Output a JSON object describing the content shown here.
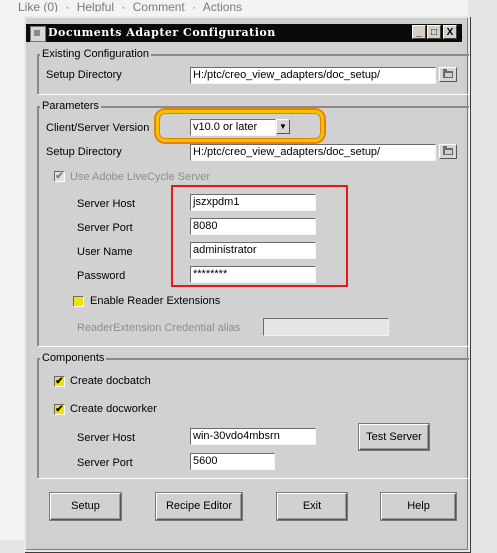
{
  "background": {
    "links": [
      "Like (0)",
      "·",
      "Helpful",
      "·",
      "Comment",
      "·",
      "Actions"
    ]
  },
  "window": {
    "title": "Documents Adapter Configuration",
    "buttons": {
      "minimize": "_",
      "maximize": "□",
      "close": "X"
    }
  },
  "existing_configuration": {
    "legend": "Existing Configuration",
    "setup_directory_label": "Setup Directory",
    "setup_directory_value": "H:/ptc/creo_view_adapters/doc_setup/"
  },
  "parameters": {
    "legend": "Parameters",
    "client_server_version_label": "Client/Server Version",
    "client_server_version_value": "v10.0 or later",
    "setup_directory_label": "Setup Directory",
    "setup_directory_value": "H:/ptc/creo_view_adapters/doc_setup/",
    "use_livecycle_label": "Use Adobe LiveCycle Server",
    "server_host_label": "Server Host",
    "server_host_value": "jszxpdm1",
    "server_port_label": "Server Port",
    "server_port_value": "8080",
    "user_name_label": "User Name",
    "user_name_value": "administrator",
    "password_label": "Password",
    "password_value": "********",
    "enable_reader_extensions_label": "Enable Reader Extensions",
    "reader_extension_alias_label": "ReaderExtension Credential alias",
    "reader_extension_alias_value": ""
  },
  "components": {
    "legend": "Components",
    "create_docbatch_label": "Create docbatch",
    "create_docworker_label": "Create docworker",
    "server_host_label": "Server Host",
    "server_host_value": "win-30vdo4mbsrn",
    "server_port_label": "Server Port",
    "server_port_value": "5600",
    "test_server_label": "Test Server"
  },
  "footer_buttons": {
    "setup": "Setup",
    "recipe_editor": "Recipe Editor",
    "exit": "Exit",
    "help": "Help"
  },
  "check_glyph": "✔",
  "colors": {
    "highlight_yellow": "#f2c200",
    "highlight_red": "#e11b1b",
    "checkbox_fill": "#f2e400",
    "titlebar": "#0a0a0a"
  }
}
